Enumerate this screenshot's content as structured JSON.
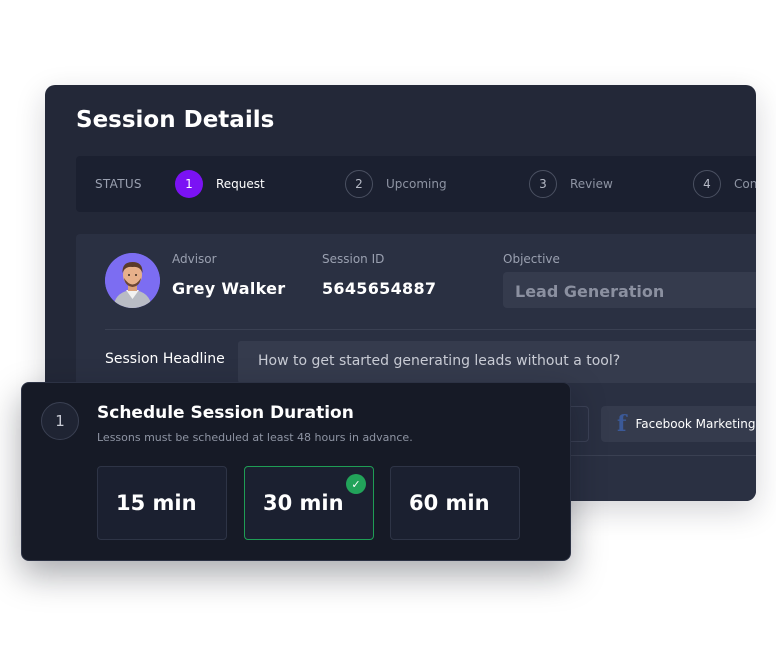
{
  "title": "Session Details",
  "status": {
    "label": "STATUS",
    "steps": [
      {
        "number": "1",
        "label": "Request",
        "active": true
      },
      {
        "number": "2",
        "label": "Upcoming",
        "active": false
      },
      {
        "number": "3",
        "label": "Review",
        "active": false
      },
      {
        "number": "4",
        "label": "Con",
        "active": false
      }
    ]
  },
  "details": {
    "advisor_label": "Advisor",
    "advisor_name": "Grey Walker",
    "session_id_label": "Session ID",
    "session_id": "5645654887",
    "objective_label": "Objective",
    "objective_value": "Lead Generation",
    "headline_label": "Session Headline",
    "headline_value": "How to get started generating leads without a tool?",
    "tag_facebook": "Facebook Marketing",
    "facebook_icon": "f"
  },
  "schedule": {
    "number": "1",
    "title": "Schedule Session Duration",
    "subtitle": "Lessons must be scheduled at least 48 hours in advance.",
    "options": [
      {
        "label": "15 min",
        "selected": false
      },
      {
        "label": "30 min",
        "selected": true
      },
      {
        "label": "60 min",
        "selected": false
      }
    ],
    "check_icon": "✓"
  },
  "colors": {
    "accent": "#7b12f4",
    "success": "#22a35a",
    "card_bg": "#232838",
    "overlay_bg": "#161a26"
  }
}
